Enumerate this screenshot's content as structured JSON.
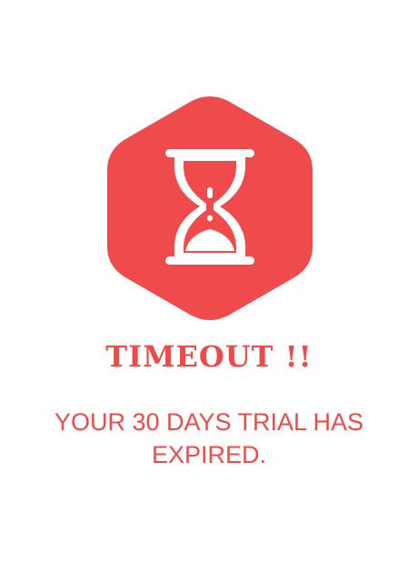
{
  "title": "TIMEOUT !!",
  "message": "YOUR 30 DAYS TRIAL HAS EXPIRED.",
  "icon": "hourglass-icon",
  "colors": {
    "accent": "#ef4b4c",
    "background": "#ffffff",
    "icon_foreground": "#ffffff"
  }
}
